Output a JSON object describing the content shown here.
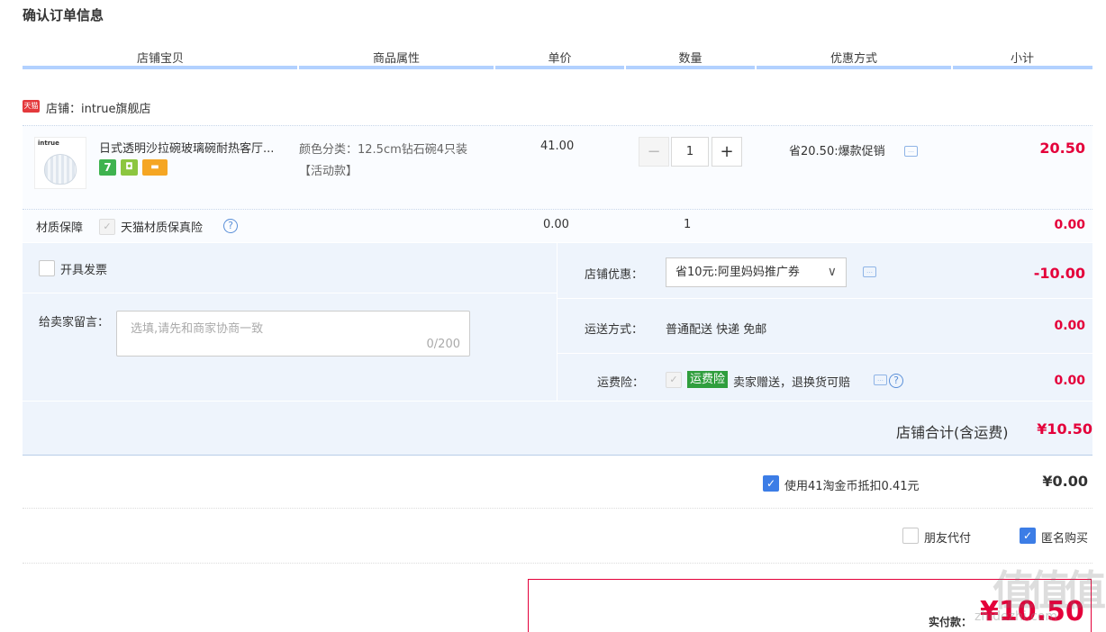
{
  "title": "确认订单信息",
  "columns": [
    "店铺宝贝",
    "商品属性",
    "单价",
    "数量",
    "优惠方式",
    "小计"
  ],
  "shop": {
    "icon_text": "天猫",
    "label": "店铺：intrue旗舰店"
  },
  "item": {
    "thumb_brand": "intrue",
    "name": "日式透明沙拉碗玻璃碗耐热客厅...",
    "attr_line1": "颜色分类：12.5cm钻石碗4只装",
    "attr_line2": "【活动款】",
    "price": "41.00",
    "qty": "1",
    "qty_minus": "−",
    "qty_plus": "+",
    "promo": "省20.50:爆款促销",
    "subtotal": "20.50",
    "badges": [
      {
        "text": "7",
        "color": "#3fb34f"
      },
      {
        "text": "◘",
        "color": "#8cc63f"
      },
      {
        "text": "▬",
        "color": "#f5a623"
      }
    ]
  },
  "guarantee": {
    "label": "材质保障",
    "option": "天猫材质保真险",
    "help": "?",
    "price": "0.00",
    "qty": "1",
    "subtotal": "0.00"
  },
  "invoice": {
    "label": "开具发票"
  },
  "message": {
    "label": "给卖家留言：",
    "placeholder": "选填,请先和商家协商一致",
    "counter": "0/200"
  },
  "shop_discount": {
    "label": "店铺优惠：",
    "selected": "省10元:阿里妈妈推广券",
    "arrow": "∨",
    "amount": "-10.00"
  },
  "shipping": {
    "label": "运送方式：",
    "value": "普通配送 快递 免邮",
    "amount": "0.00"
  },
  "insurance": {
    "label": "运费险：",
    "tag": "运费险",
    "text": "卖家赠送，退换货可赔",
    "help": "?",
    "amount": "0.00"
  },
  "shop_total": {
    "label": "店铺合计(含运费)",
    "amount": "¥10.50"
  },
  "coins": {
    "label": "使用41淘金币抵扣0.41元",
    "amount": "¥0.00",
    "checked": true
  },
  "options": {
    "friend_pay": "朋友代付",
    "anonymous": "匿名购买"
  },
  "pay": {
    "label": "实付款：",
    "amount": "¥10.50"
  },
  "watermark": {
    "logo": "值值值",
    "site": "zhidezhi.com"
  },
  "colors": {
    "accent": "#e4003a",
    "header_line": "#b2d1ff",
    "panel": "#eef4fc",
    "check": "#3c7de6"
  }
}
